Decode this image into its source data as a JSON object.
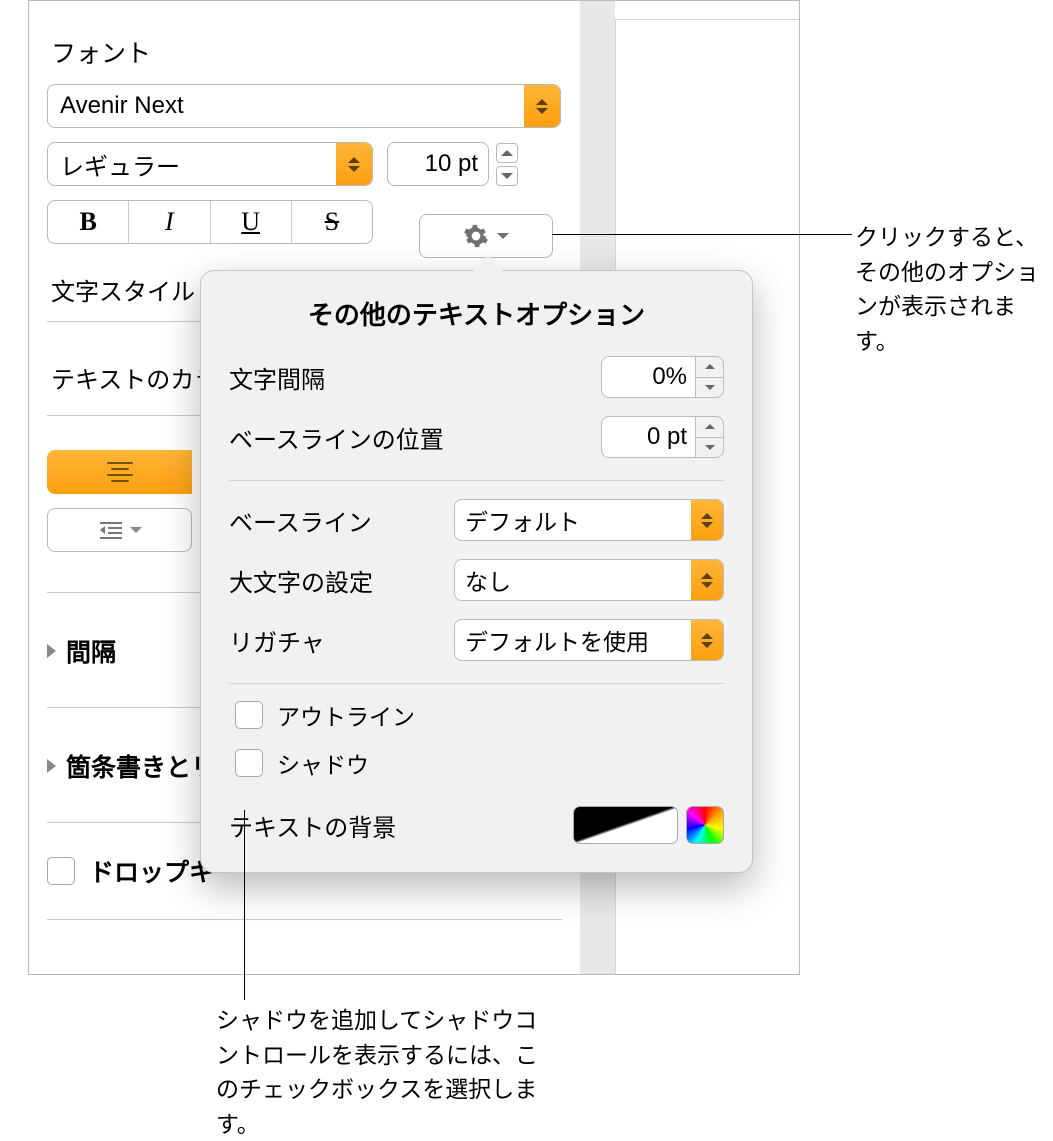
{
  "font": {
    "section_label": "フォント",
    "family": "Avenir Next",
    "style": "レギュラー",
    "size": "10 pt",
    "bold": "B",
    "italic": "I",
    "underline": "U",
    "strike": "S"
  },
  "char_style_label": "文字スタイル",
  "text_color_label": "テキストのカラー",
  "spacing_label": "間隔",
  "bullets_label": "箇条書きとリ",
  "dropcap_label": "ドロップキ",
  "popover": {
    "title": "その他のテキストオプション",
    "char_spacing_label": "文字間隔",
    "char_spacing_value": "0%",
    "baseline_shift_label": "ベースラインの位置",
    "baseline_shift_value": "0 pt",
    "baseline_label": "ベースライン",
    "baseline_value": "デフォルト",
    "caps_label": "大文字の設定",
    "caps_value": "なし",
    "ligature_label": "リガチャ",
    "ligature_value": "デフォルトを使用",
    "outline_label": "アウトライン",
    "shadow_label": "シャドウ",
    "textbg_label": "テキストの背景"
  },
  "callouts": {
    "gear": "クリックすると、その他のオプションが表示されます。",
    "shadow": "シャドウを追加してシャドウコントロールを表示するには、このチェックボックスを選択します。"
  }
}
